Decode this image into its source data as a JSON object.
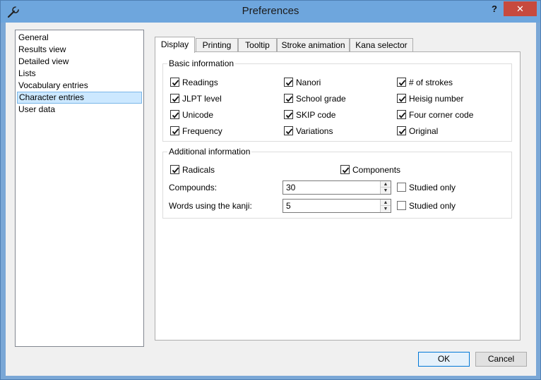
{
  "window": {
    "title": "Preferences",
    "help_label": "?",
    "close_label": "✕"
  },
  "nav": {
    "items": [
      {
        "label": "General",
        "selected": false
      },
      {
        "label": "Results view",
        "selected": false
      },
      {
        "label": "Detailed view",
        "selected": false
      },
      {
        "label": "Lists",
        "selected": false
      },
      {
        "label": "Vocabulary entries",
        "selected": false
      },
      {
        "label": "Character entries",
        "selected": true
      },
      {
        "label": "User data",
        "selected": false
      }
    ]
  },
  "tabs": [
    {
      "label": "Display",
      "active": true
    },
    {
      "label": "Printing",
      "active": false
    },
    {
      "label": "Tooltip",
      "active": false
    },
    {
      "label": "Stroke animation",
      "active": false
    },
    {
      "label": "Kana selector",
      "active": false
    }
  ],
  "basic": {
    "title": "Basic information",
    "options": [
      {
        "label": "Readings",
        "checked": true
      },
      {
        "label": "Nanori",
        "checked": true
      },
      {
        "label": "# of strokes",
        "checked": true
      },
      {
        "label": "JLPT level",
        "checked": true
      },
      {
        "label": "School grade",
        "checked": true
      },
      {
        "label": "Heisig number",
        "checked": true
      },
      {
        "label": "Unicode",
        "checked": true
      },
      {
        "label": "SKIP code",
        "checked": true
      },
      {
        "label": "Four corner code",
        "checked": true
      },
      {
        "label": "Frequency",
        "checked": true
      },
      {
        "label": "Variations",
        "checked": true
      },
      {
        "label": "Original",
        "checked": true
      }
    ]
  },
  "additional": {
    "title": "Additional information",
    "radicals": {
      "label": "Radicals",
      "checked": true
    },
    "components": {
      "label": "Components",
      "checked": true
    },
    "compounds": {
      "label": "Compounds:",
      "value": "30",
      "studied_label": "Studied only",
      "studied_checked": false
    },
    "words": {
      "label": "Words using the kanji:",
      "value": "5",
      "studied_label": "Studied only",
      "studied_checked": false
    }
  },
  "buttons": {
    "ok": "OK",
    "cancel": "Cancel"
  }
}
